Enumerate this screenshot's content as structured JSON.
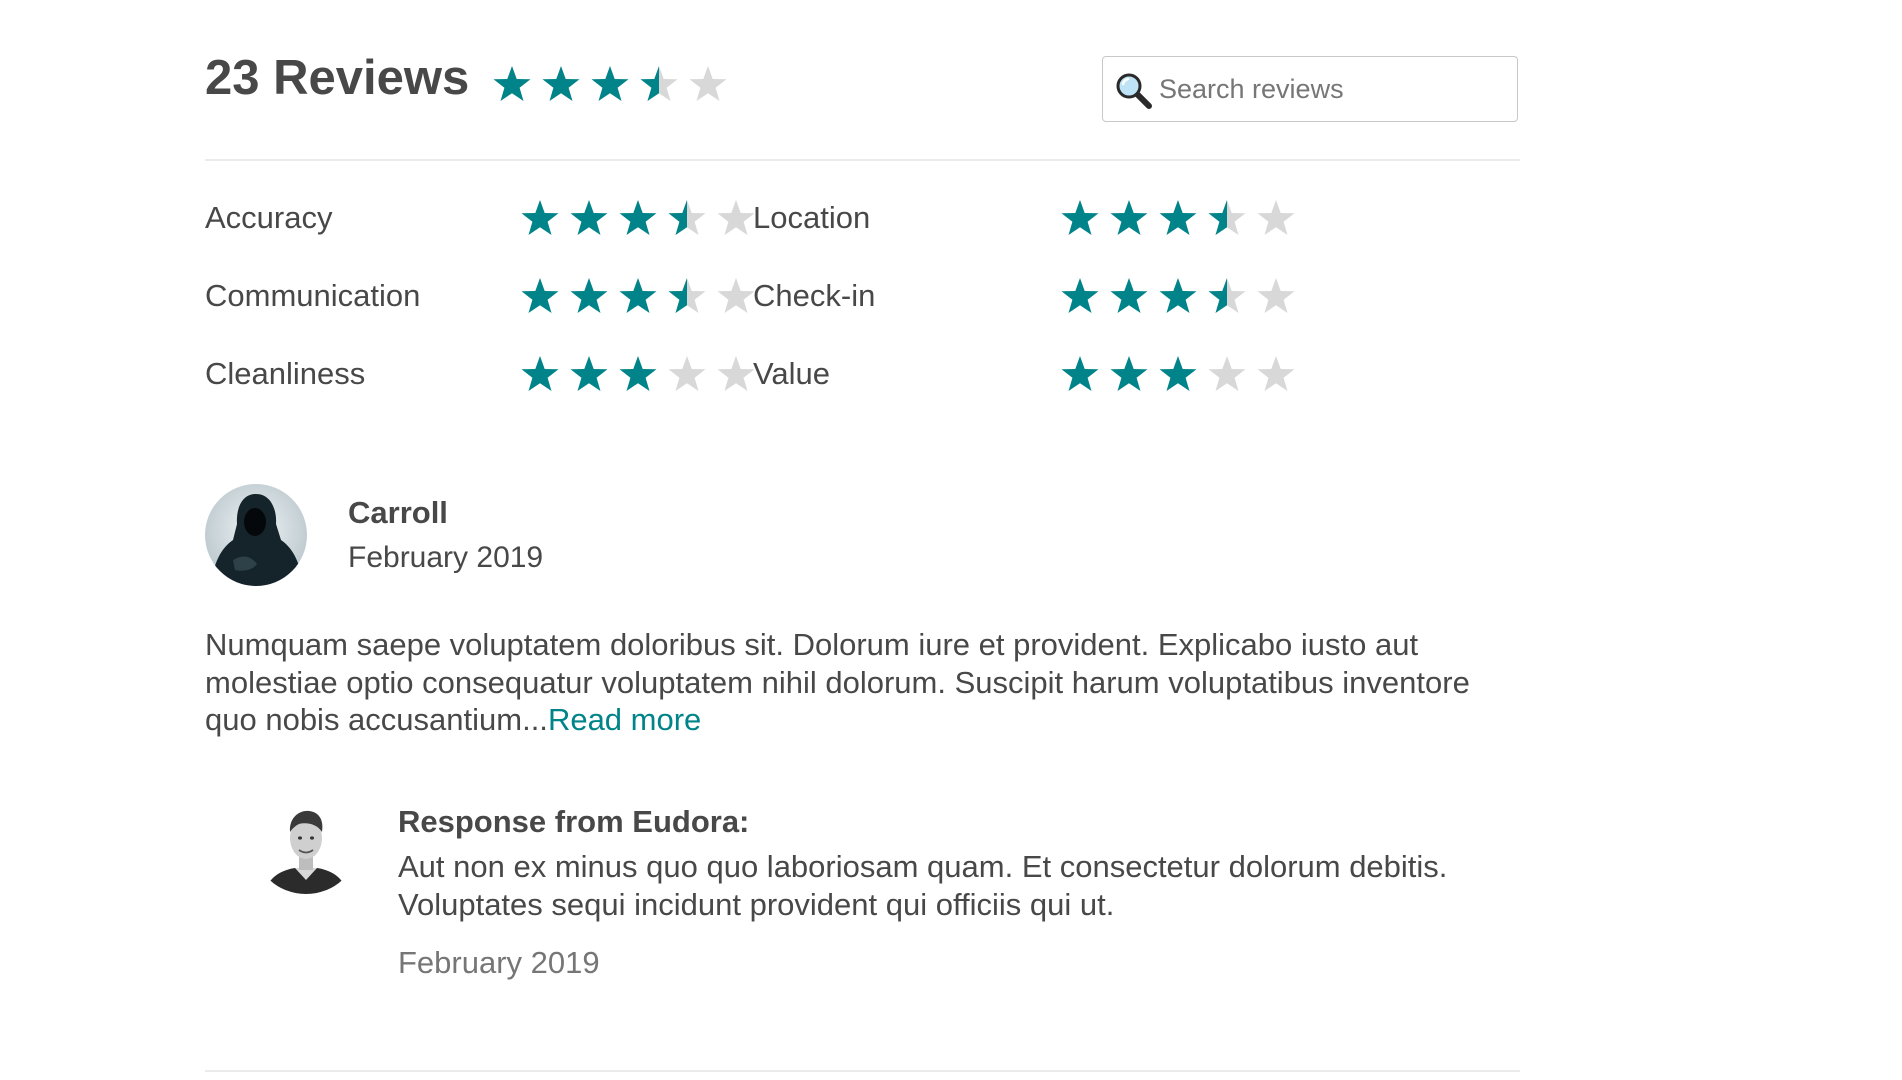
{
  "header": {
    "title": "23 Reviews",
    "overall_rating": 3.5,
    "rating_max": 5
  },
  "search": {
    "placeholder": "Search reviews",
    "icon": "magnifying-glass-icon"
  },
  "categories": [
    {
      "label": "Accuracy",
      "rating": 3.5
    },
    {
      "label": "Location",
      "rating": 3.5
    },
    {
      "label": "Communication",
      "rating": 3.5
    },
    {
      "label": "Check-in",
      "rating": 3.5
    },
    {
      "label": "Cleanliness",
      "rating": 3
    },
    {
      "label": "Value",
      "rating": 3
    }
  ],
  "review": {
    "name": "Carroll",
    "date": "February 2019",
    "text": "Numquam saepe voluptatem doloribus sit. Dolorum iure et provident. Explicabo iusto aut molestiae optio consequatur voluptatem nihil dolorum. Suscipit harum voluptatibus inventore quo nobis accusantium...",
    "read_more": "Read more"
  },
  "response": {
    "title": "Response from Eudora:",
    "text": "Aut non ex minus quo quo laboriosam quam. Et consectetur dolorum debitis. Voluptates sequi incidunt provident qui officiis qui ut.",
    "date": "February 2019"
  },
  "colors": {
    "star_filled": "#008489",
    "star_empty": "#d8d8d8",
    "link": "#008489",
    "text": "#484848",
    "muted": "#767676",
    "divider": "#ebebeb"
  }
}
